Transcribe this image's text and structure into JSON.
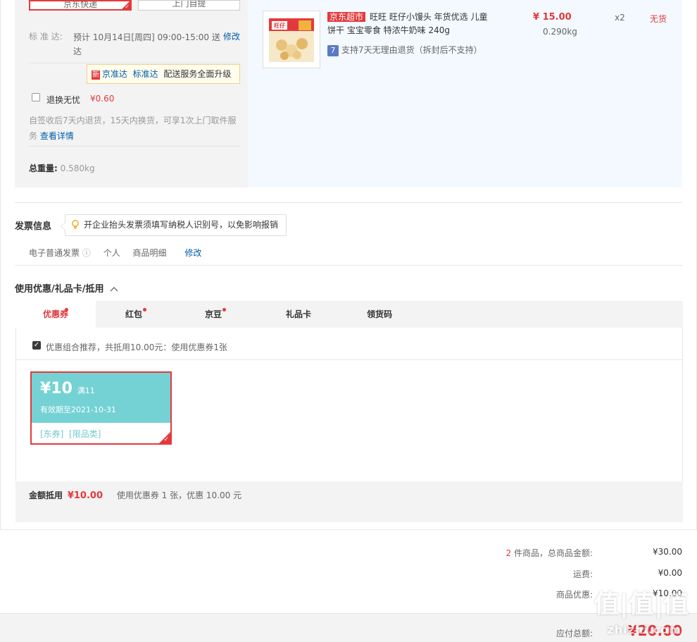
{
  "shipping": {
    "option_selected": "京东快递",
    "option_other": "上门自提",
    "standard_label": "标 准 达:",
    "standard_time_line1": "预计 10月14日[周四] 09:00-15:00 送",
    "standard_time_line2": "达",
    "modify": "修改",
    "upgrade_new": "新",
    "upgrade_link1": "京准达",
    "upgrade_link2": "标准达",
    "upgrade_text": "配送服务全面升级",
    "return_label": "退换无忧",
    "return_price": "¥0.60",
    "return_desc_line1": "自签收后7天内退货，15天内换货，可享1次上门取件服",
    "return_desc_line2": "务",
    "return_detail": "查看详情",
    "weight_label": "总重量:",
    "weight_value": "0.580kg"
  },
  "product": {
    "shop_tag": "京东超市",
    "title_line1": "旺旺 旺仔小馒头 年货优选 儿童",
    "title_line2": "饼干 宝宝零食 特浓牛奶味 240g",
    "price": "¥ 15.00",
    "weight": "0.290kg",
    "qty": "x2",
    "stock": "无货",
    "return_badge": "7",
    "return_text": "支持7天无理由退货（拆封后不支持）",
    "pack_text": "旺仔"
  },
  "invoice": {
    "title": "发票信息",
    "tip": "开企业抬头发票须填写纳税人识别号，以免影响报销",
    "type": "电子普通发票",
    "info_icon": "ⓘ",
    "person": "个人",
    "detail": "商品明细",
    "modify": "修改"
  },
  "coupons": {
    "title": "使用优惠/礼品卡/抵用",
    "tabs": [
      "优惠券",
      "红包",
      "京豆",
      "礼品卡",
      "领货码"
    ],
    "recommend": "优惠组合推荐，共抵用10.00元：使用优惠券1张",
    "amount": "¥10",
    "condition": "满11",
    "validity": "有效期至2021-10-31",
    "tag1": "[东券]",
    "tag2": "[限品类]",
    "summary_label": "金额抵用",
    "summary_amount": "¥10.00",
    "summary_text": "使用优惠券 1 张，优惠 10.00 元"
  },
  "totals": {
    "count": "2",
    "count_suffix": "件商品，总商品金额:",
    "goods_total": "¥30.00",
    "shipping_label": "运费:",
    "shipping_value": "¥0.00",
    "discount_label": "商品优惠:",
    "discount_value": "¥10.00",
    "payable_label": "应付总额:",
    "payable_value": "¥20.00"
  },
  "watermark": {
    "logo": "值|值|值",
    "site": "zhizhi.com"
  },
  "colors": {
    "accent": "#e4393c",
    "link": "#005ea7",
    "coupon": "#74d2d4"
  }
}
